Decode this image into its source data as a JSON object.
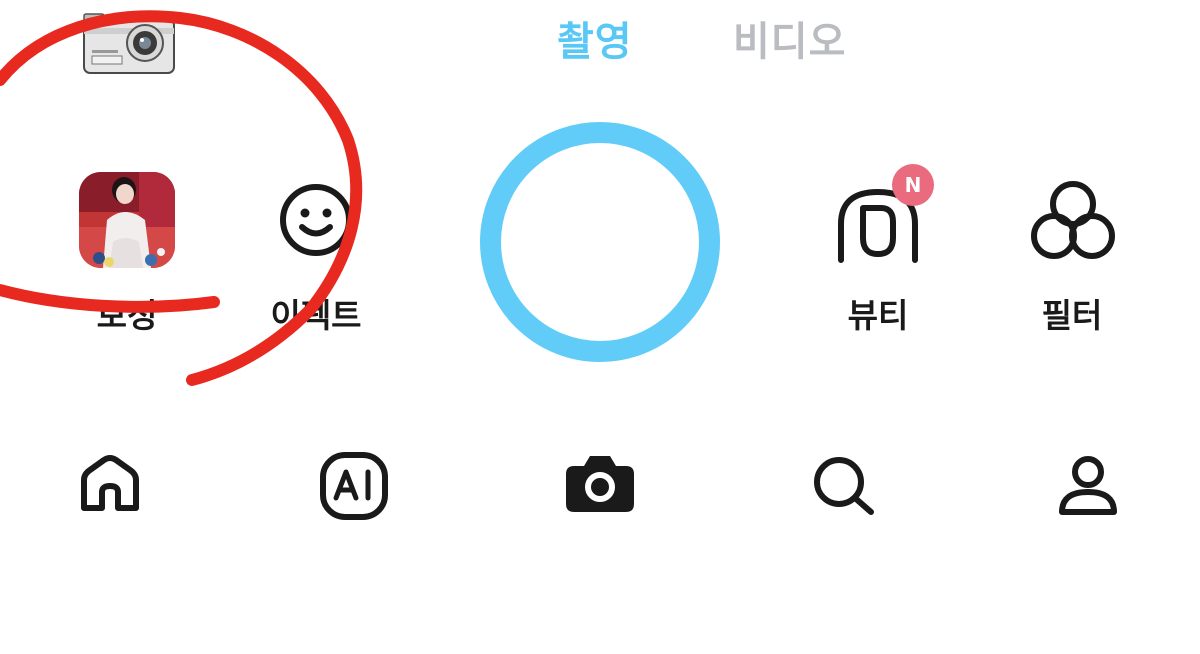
{
  "modes": {
    "photo_label": "촬영",
    "video_label": "비디오",
    "active": "photo",
    "active_color": "#5ac8f5",
    "inactive_color": "#b9bcc0"
  },
  "tools": {
    "correction_label": "보정",
    "effect_label": "이펙트",
    "beauty_label": "뷰티",
    "filter_label": "필터"
  },
  "beauty_badge": {
    "text": "N",
    "color": "#ea6a7e"
  },
  "shutter": {
    "ring_color": "#62ccf8"
  },
  "bottom_nav": {
    "items": [
      {
        "icon": "home-icon"
      },
      {
        "icon": "ai-icon",
        "text": "AI"
      },
      {
        "icon": "camera-icon",
        "active": true
      },
      {
        "icon": "search-icon"
      },
      {
        "icon": "profile-icon"
      }
    ]
  },
  "annotation": {
    "color": "#e8291f",
    "shape": "freehand-circle"
  }
}
